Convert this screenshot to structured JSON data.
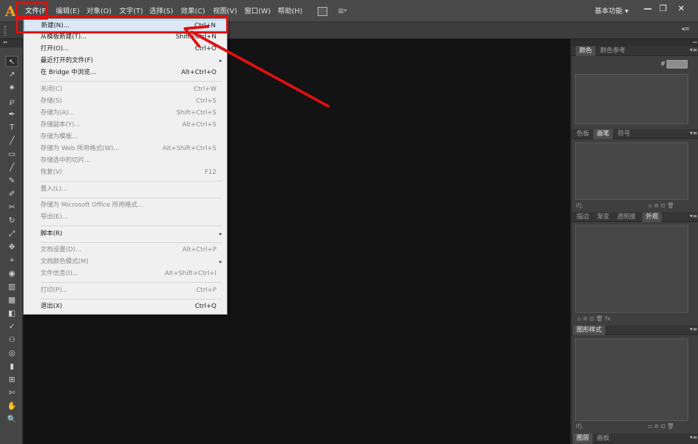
{
  "app": {
    "logo": "A",
    "menus": [
      "文件(F)",
      "编辑(E)",
      "对象(O)",
      "文字(T)",
      "选择(S)",
      "效果(C)",
      "视图(V)",
      "窗口(W)",
      "帮助(H)"
    ],
    "arrange_label": "▦▾",
    "workspace": "基本功能",
    "workspace_arrow": "▾",
    "window_buttons": [
      "—",
      "❐",
      "✕"
    ],
    "control_menu": "◂≡"
  },
  "file_menu": {
    "items": [
      {
        "label": "新建(N)...",
        "shortcut": "Ctrl+N"
      },
      {
        "label": "从模板新建(T)...",
        "shortcut": "Shift+Ctrl+N"
      },
      {
        "label": "打开(O)...",
        "shortcut": "Ctrl+O"
      },
      {
        "label": "最近打开的文件(F)",
        "submenu": "▸"
      },
      {
        "label": "在 Bridge 中浏览...",
        "shortcut": "Alt+Ctrl+O"
      },
      {
        "label": "关闭(C)",
        "shortcut": "Ctrl+W"
      },
      {
        "label": "存储(S)",
        "shortcut": "Ctrl+S"
      },
      {
        "label": "存储为(A)...",
        "shortcut": "Shift+Ctrl+S"
      },
      {
        "label": "存储副本(Y)...",
        "shortcut": "Alt+Ctrl+S"
      },
      {
        "label": "存储为模板..."
      },
      {
        "label": "存储为 Web 所用格式(W)...",
        "shortcut": "Alt+Shift+Ctrl+S"
      },
      {
        "label": "存储选中的切片..."
      },
      {
        "label": "恢复(V)",
        "shortcut": "F12"
      },
      {
        "label": "置入(L)..."
      },
      {
        "label": "存储为 Microsoft Office 所用格式..."
      },
      {
        "label": "导出(E)..."
      },
      {
        "label": "脚本(R)",
        "submenu": "▸"
      },
      {
        "label": "文档设置(D)...",
        "shortcut": "Alt+Ctrl+P"
      },
      {
        "label": "文档颜色模式(M)",
        "submenu": "▸"
      },
      {
        "label": "文件信息(I)...",
        "shortcut": "Alt+Shift+Ctrl+I"
      },
      {
        "label": "打印(P)...",
        "shortcut": "Ctrl+P"
      },
      {
        "label": "退出(X)",
        "shortcut": "Ctrl+Q"
      }
    ]
  },
  "panels": {
    "collapse": "◂◂",
    "color_tabs": [
      "颜色",
      "颜色参考"
    ],
    "hex_label": "#",
    "swatch_tabs": [
      "色板",
      "画笔",
      "符号"
    ],
    "appearance_tabs": [
      "描边",
      "渐变",
      "透明度",
      "外观"
    ],
    "graphic_styles_tab": "图形样式",
    "layers_tabs": [
      "图层",
      "画板"
    ],
    "menu_glyph": "▾≡",
    "footer_lib": "lŊ.",
    "footer_fx": "fx.",
    "footer_icons": "▫ ⊘ ⊡ 🗑"
  },
  "tools": {
    "header": "◂◂",
    "glyphs": [
      "↖",
      "↗",
      "✷",
      "℘",
      "✒",
      "T",
      "╱",
      "▭",
      "╱",
      "✎",
      "✐",
      "✂",
      "↻",
      "⤢",
      "✥",
      "⌖",
      "◉",
      "▥",
      "▦",
      "◧",
      "✓",
      "⚇",
      "◎",
      "▮",
      "⊞",
      "✄",
      "✋",
      "🔍"
    ]
  },
  "colors": {
    "accent_red": "#e01010",
    "canvas": "#131313",
    "menu_bg": "#f0f0f0"
  }
}
